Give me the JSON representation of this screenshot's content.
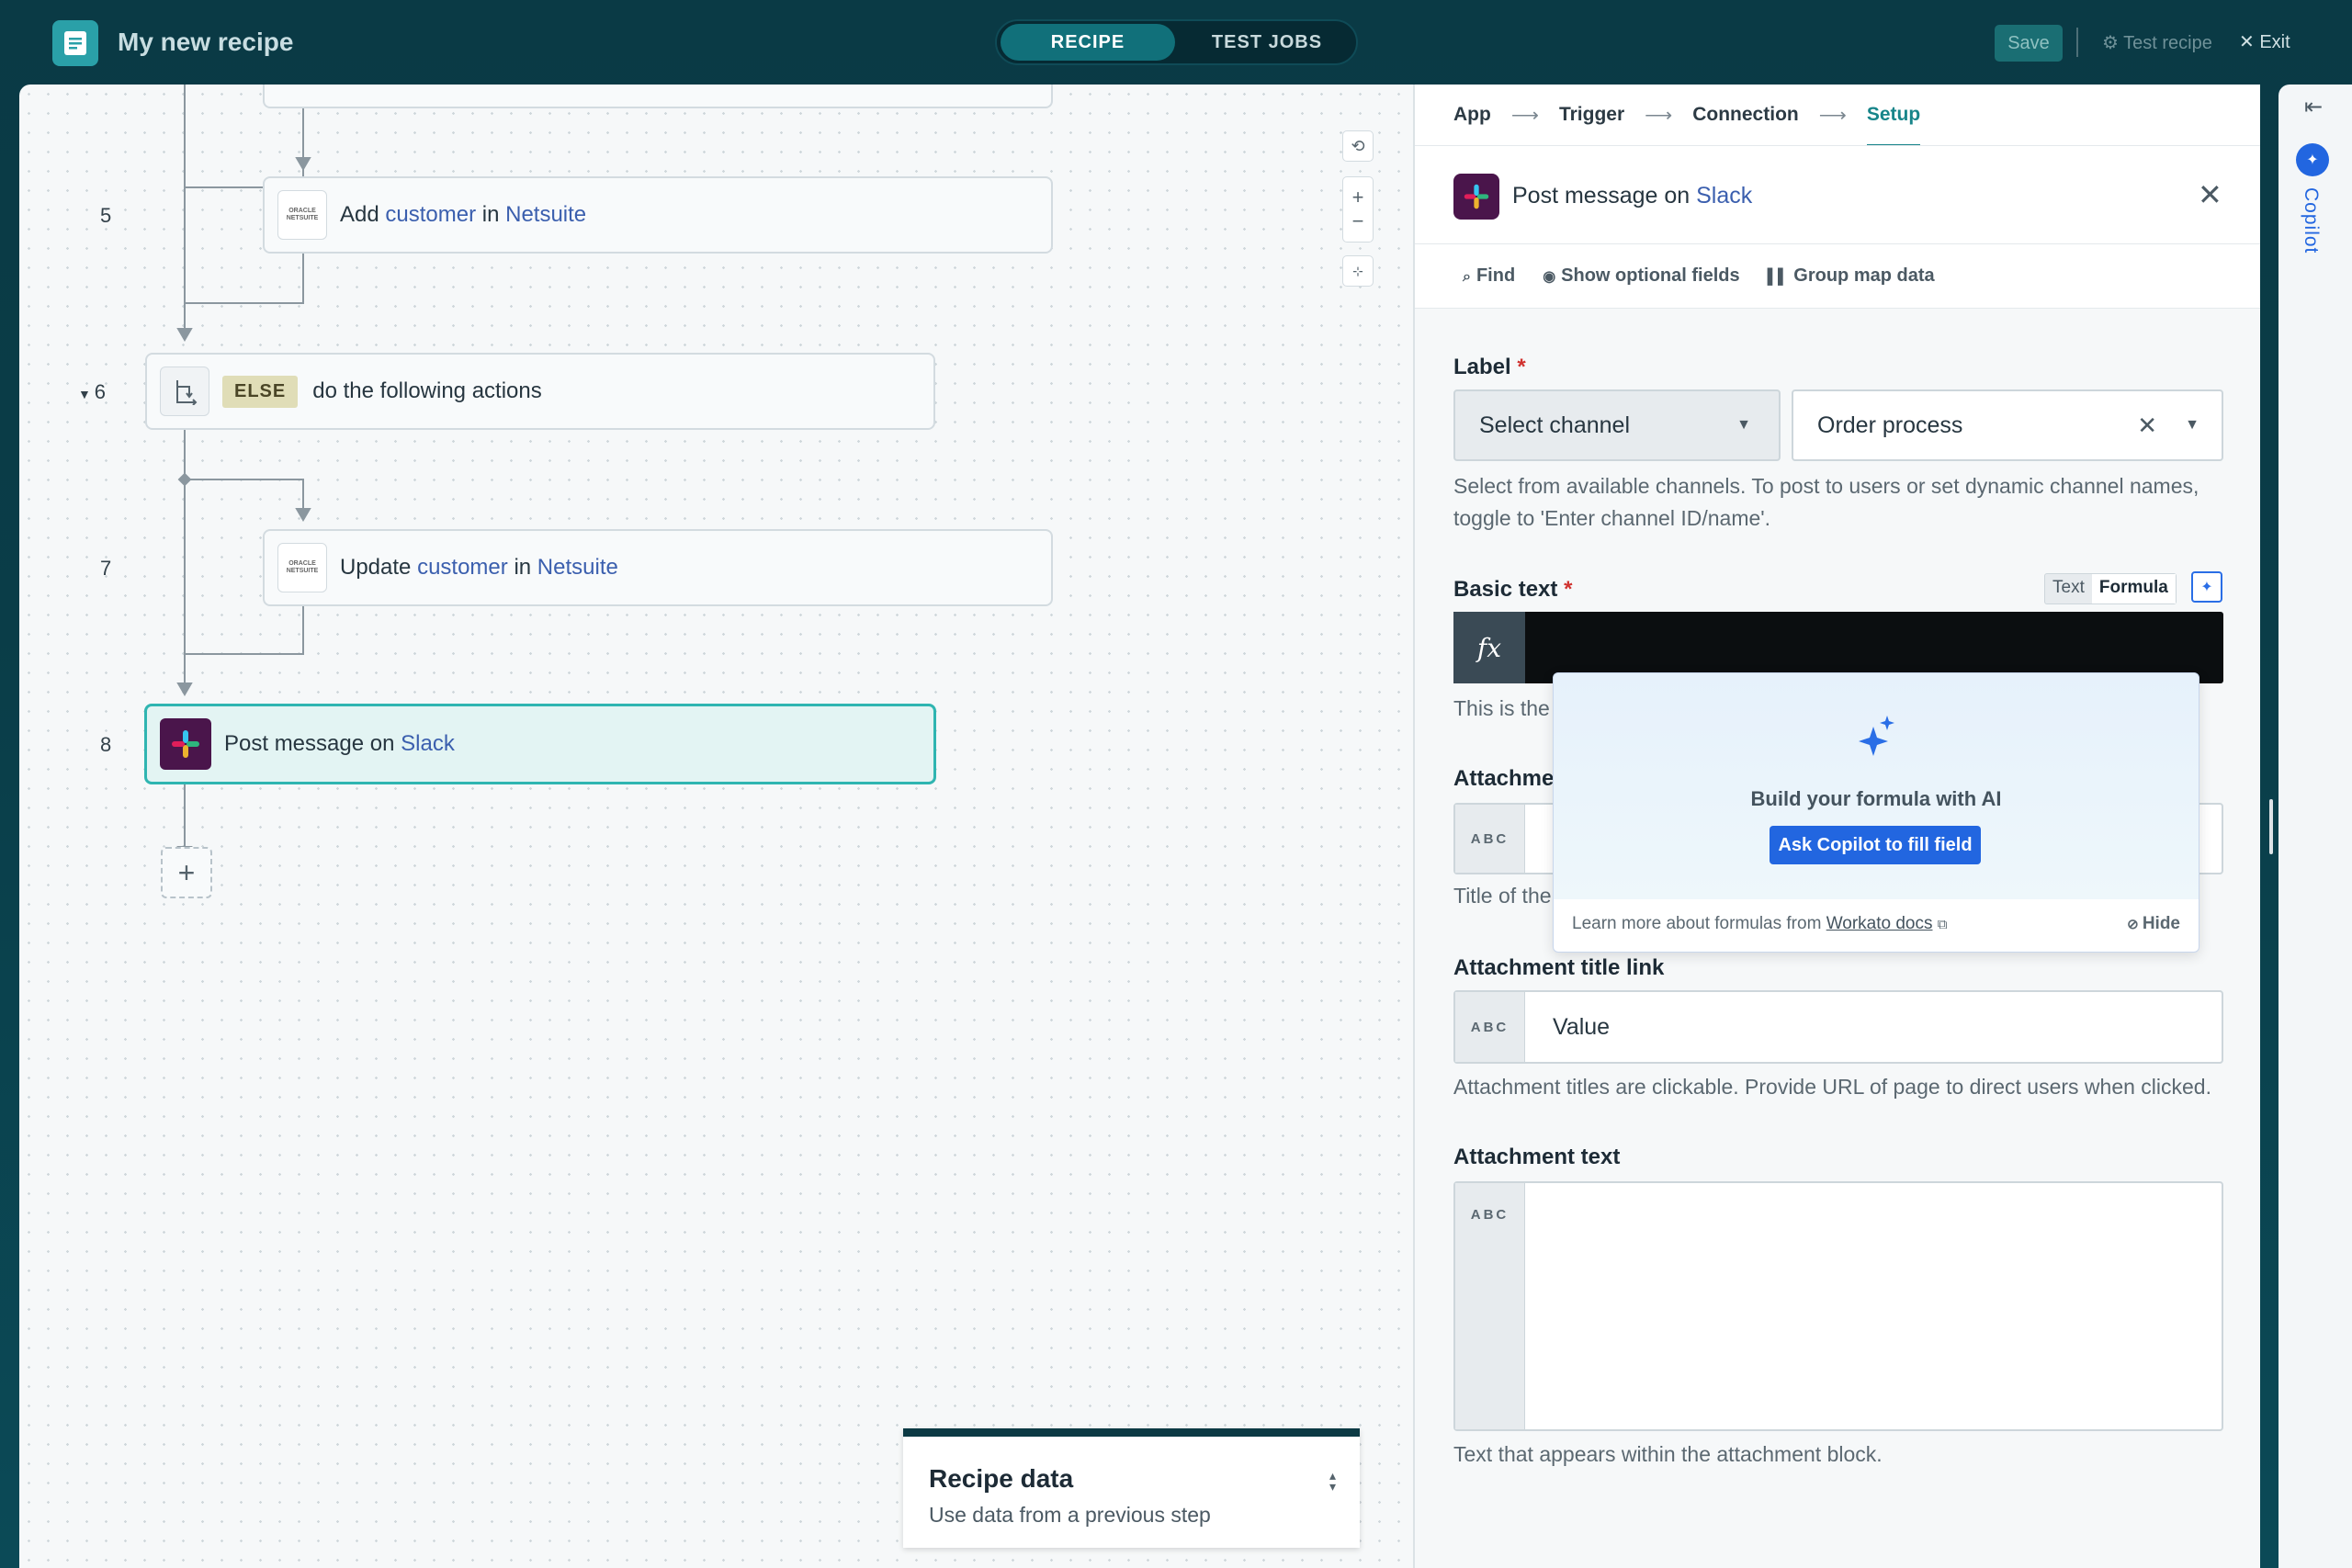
{
  "header": {
    "title": "My new recipe",
    "tabs": [
      "RECIPE",
      "TEST JOBS"
    ],
    "save_label": "Save",
    "test_recipe_label": "Test recipe",
    "exit_label": "Exit"
  },
  "canvas": {
    "steps": [
      {
        "num": "5",
        "verb": "Add",
        "object": "customer",
        "prep": "in",
        "app": "Netsuite",
        "logo_text": "ORACLE NETSUITE"
      },
      {
        "num": "6",
        "badge": "ELSE",
        "text": "do the following actions"
      },
      {
        "num": "7",
        "verb": "Update",
        "object": "customer",
        "prep": "in",
        "app": "Netsuite",
        "logo_text": "ORACLE NETSUITE"
      },
      {
        "num": "8",
        "verb": "Post message",
        "prep": "on",
        "app": "Slack"
      }
    ],
    "recipe_data": {
      "title": "Recipe data",
      "subtitle": "Use data from a previous step"
    }
  },
  "panel": {
    "breadcrumbs": [
      "App",
      "Trigger",
      "Connection",
      "Setup"
    ],
    "action": {
      "verb": "Post message on",
      "app": "Slack"
    },
    "tools": [
      "Find",
      "Show optional fields",
      "Group map data"
    ],
    "label_field": {
      "label": "Label",
      "select_placeholder": "Select channel",
      "value": "Order process",
      "help": "Select from available channels. To post to users or set dynamic channel names, toggle to 'Enter channel ID/name'."
    },
    "basic_text": {
      "label": "Basic text",
      "toggle": [
        "Text",
        "Formula"
      ],
      "help_visible": "This is the",
      "fx": "fx"
    },
    "attachment_title": {
      "label_visible": "Attachmer",
      "help_visible": "Title of the",
      "abc": "ABC"
    },
    "attachment_title_link": {
      "label": "Attachment title link",
      "value": "Value",
      "help": "Attachment titles are clickable. Provide URL of page to direct users when clicked.",
      "abc": "ABC"
    },
    "attachment_text": {
      "label": "Attachment text",
      "help": "Text that appears within the attachment block.",
      "abc": "ABC"
    },
    "popup": {
      "title": "Build your formula with AI",
      "button": "Ask Copilot to fill field",
      "footer_prefix": "Learn more about formulas from",
      "footer_link": "Workato docs",
      "hide": "Hide"
    }
  },
  "rail": {
    "copilot_label": "Copilot"
  },
  "colors": {
    "accent": "#18858a",
    "link": "#3b5fae",
    "copilot": "#2266e0",
    "required": "#d0322f"
  }
}
